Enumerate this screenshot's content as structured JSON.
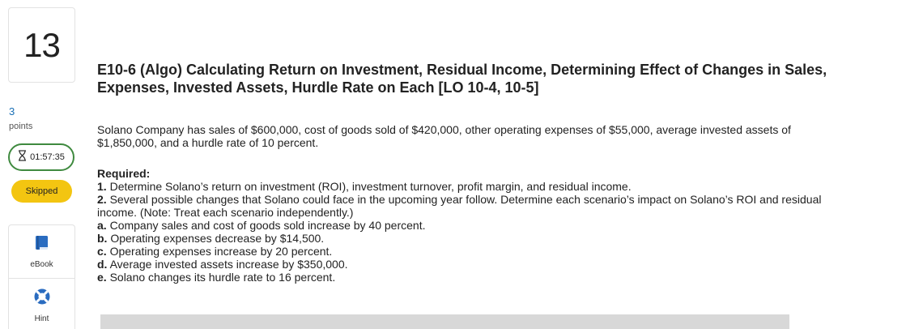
{
  "question": {
    "number": "13",
    "points_value": "3",
    "points_label": "points",
    "timer": "01:57:35",
    "status": "Skipped"
  },
  "tools": {
    "ebook_label": "eBook",
    "hint_label": "Hint"
  },
  "colors": {
    "points_blue": "#1a6fb5",
    "timer_green": "#3f8a3f",
    "skipped_yellow": "#f3c511",
    "ebook_blue": "#2a6cc0"
  },
  "icons": {
    "timer": "hourglass-icon",
    "ebook": "book-icon",
    "hint": "lifebuoy-icon"
  },
  "problem": {
    "title": "E10-6 (Algo) Calculating Return on Investment, Residual Income, Determining Effect of Changes in Sales, Expenses, Invested Assets, Hurdle Rate on Each [LO 10-4, 10-5]",
    "intro": "Solano Company has sales of $600,000, cost of goods sold of $420,000, other operating expenses of $55,000, average invested assets of $1,850,000, and a hurdle rate of 10 percent.",
    "required_heading": "Required:",
    "items": [
      {
        "marker": "1.",
        "text": " Determine Solano’s return on investment (ROI), investment turnover, profit margin, and residual income."
      },
      {
        "marker": "2.",
        "text": " Several possible changes that Solano could face in the upcoming year follow. Determine each scenario’s impact on Solano’s ROI and residual income. (Note: Treat each scenario independently.)"
      },
      {
        "marker": "a.",
        "text": " Company sales and cost of goods sold increase by 40 percent."
      },
      {
        "marker": "b.",
        "text": " Operating expenses decrease by $14,500."
      },
      {
        "marker": "c.",
        "text": " Operating expenses increase by 20 percent."
      },
      {
        "marker": "d.",
        "text": " Average invested assets increase by $350,000."
      },
      {
        "marker": "e.",
        "text": " Solano changes its hurdle rate to 16 percent."
      }
    ]
  }
}
